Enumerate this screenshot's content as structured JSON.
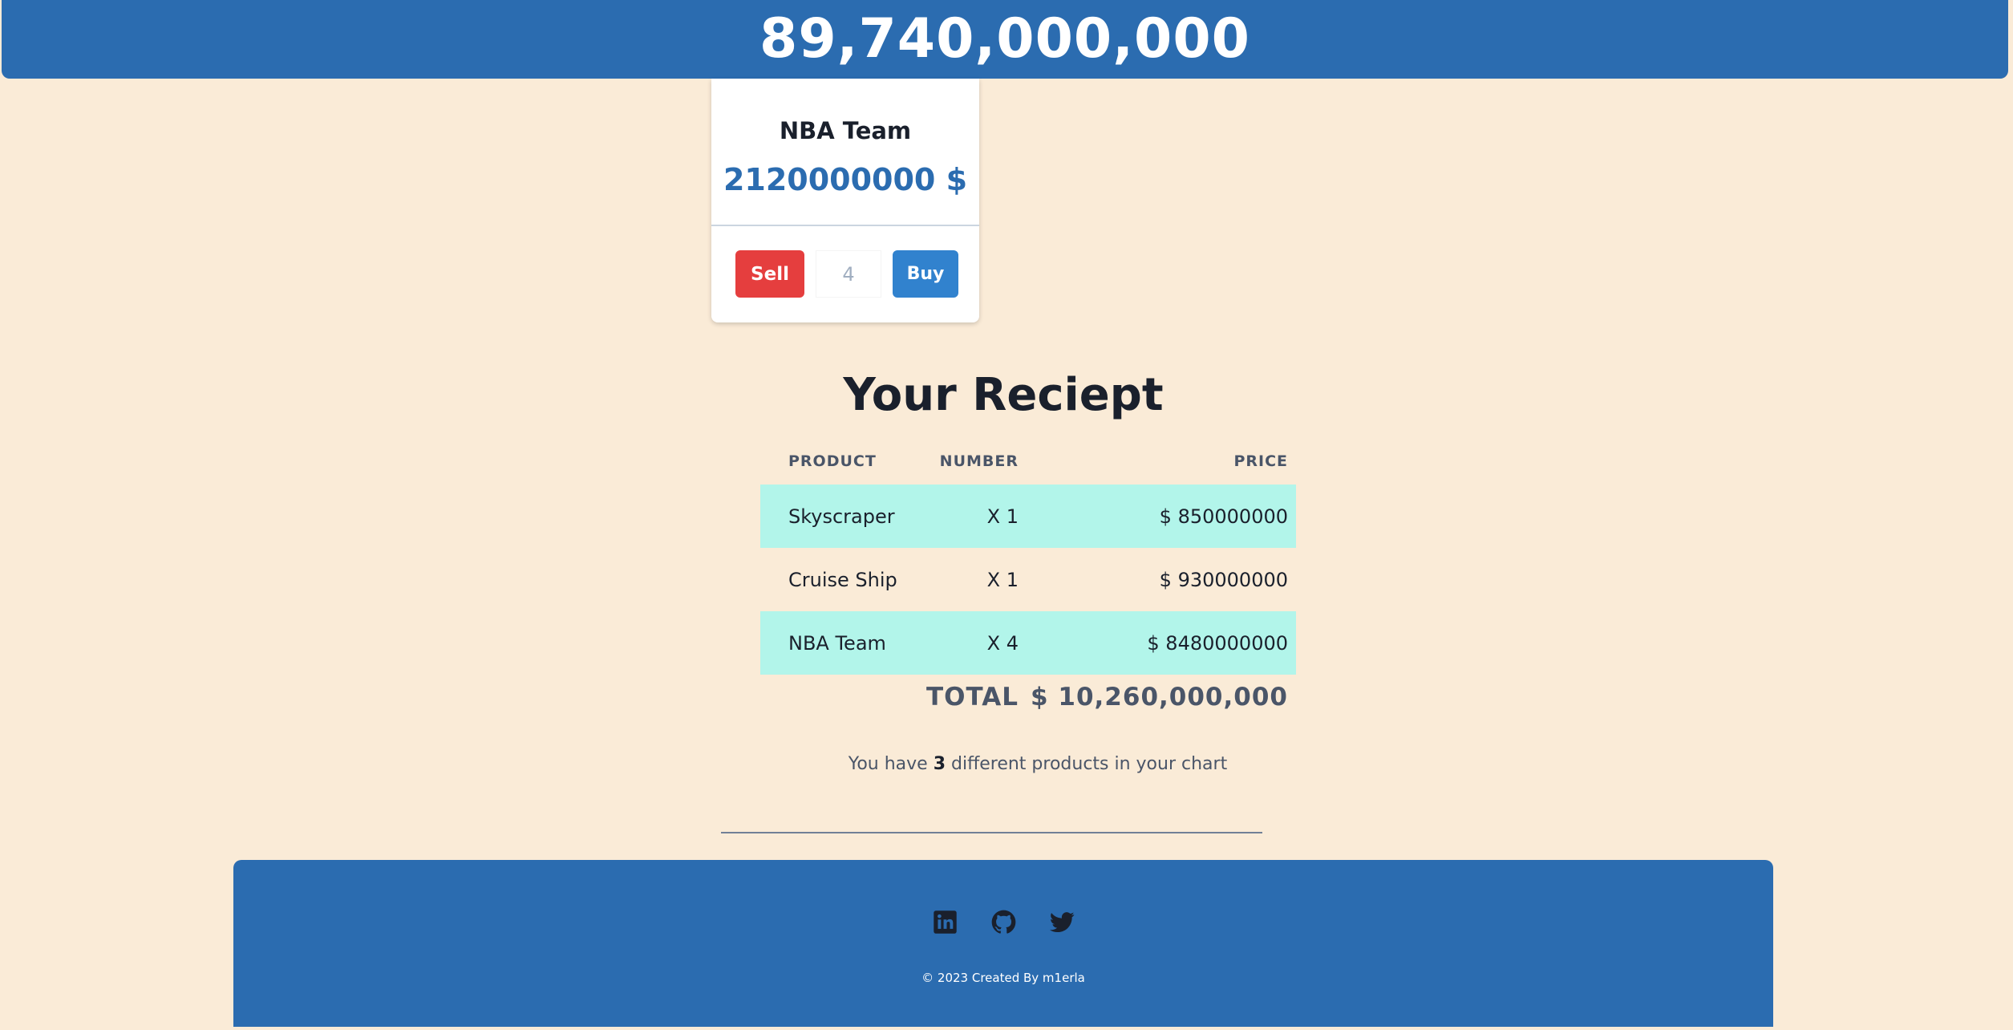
{
  "header": {
    "money": "89,740,000,000"
  },
  "product_card": {
    "name": "NBA Team",
    "price": "2120000000 $",
    "sell_label": "Sell",
    "quantity": "4",
    "buy_label": "Buy"
  },
  "receipt": {
    "title": "Your Reciept",
    "columns": {
      "product": "PRODUCT",
      "number": "NUMBER",
      "price": "PRICE"
    },
    "rows": [
      {
        "product": "Skyscraper",
        "number": "X 1",
        "price": "$ 850000000"
      },
      {
        "product": "Cruise Ship",
        "number": "X 1",
        "price": "$ 930000000"
      },
      {
        "product": "NBA Team",
        "number": "X 4",
        "price": "$ 8480000000"
      }
    ],
    "total_label": "TOTAL",
    "total_value": "$ 10,260,000,000",
    "summary_prefix": "You have ",
    "summary_count": "3",
    "summary_suffix": " different products in your chart"
  },
  "footer": {
    "copyright": "© 2023 Created By m1erla",
    "icons": [
      "linkedin-icon",
      "github-icon",
      "twitter-icon"
    ]
  },
  "colors": {
    "background": "#faebd7",
    "brand_blue": "#2b6cb0",
    "sell_red": "#e53e3e",
    "buy_blue": "#3182ce",
    "row_highlight": "#b2f5ea"
  }
}
